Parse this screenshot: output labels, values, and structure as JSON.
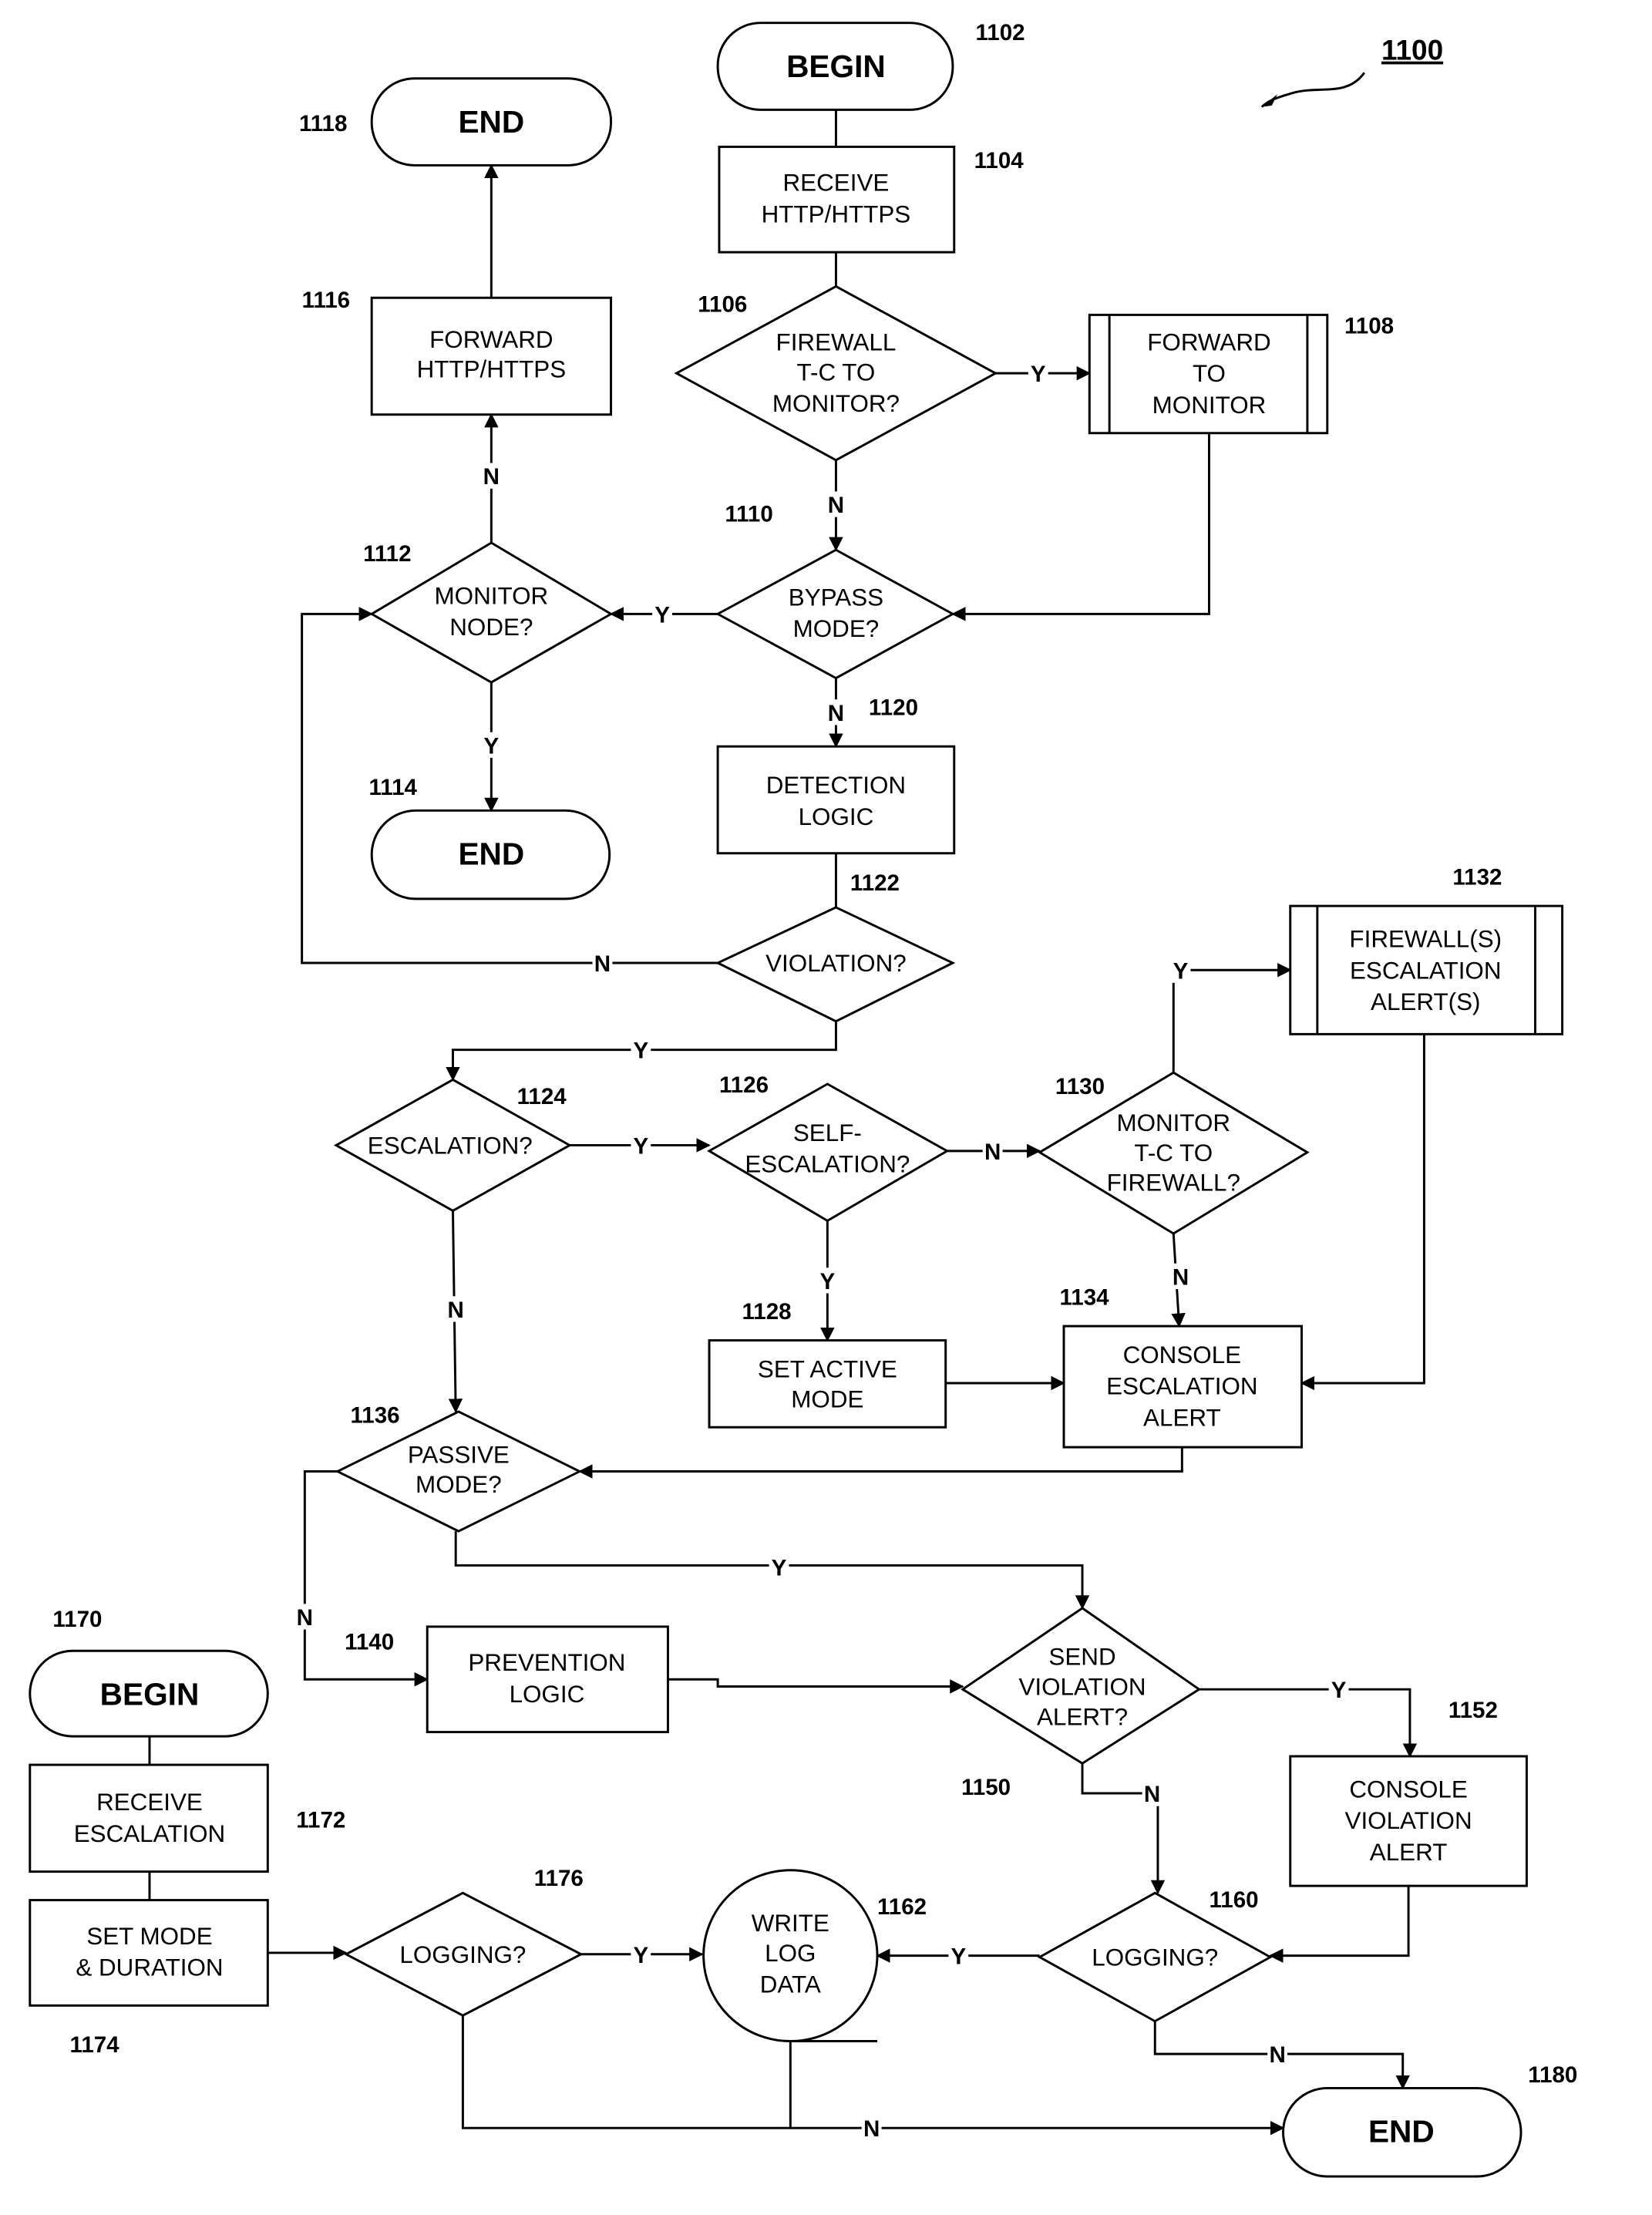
{
  "figure": {
    "number": "1100",
    "type": "flowchart"
  },
  "nodes": [
    {
      "id": "1102",
      "kind": "terminal",
      "lines": [
        "BEGIN"
      ]
    },
    {
      "id": "1104",
      "kind": "process",
      "lines": [
        "RECEIVE",
        "HTTP/HTTPS"
      ]
    },
    {
      "id": "1106",
      "kind": "decision",
      "lines": [
        "FIREWALL",
        "T-C TO",
        "MONITOR?"
      ]
    },
    {
      "id": "1108",
      "kind": "predefined",
      "lines": [
        "FORWARD",
        "TO",
        "MONITOR"
      ]
    },
    {
      "id": "1110",
      "kind": "decision",
      "lines": [
        "BYPASS",
        "MODE?"
      ]
    },
    {
      "id": "1112",
      "kind": "decision",
      "lines": [
        "MONITOR",
        "NODE?"
      ]
    },
    {
      "id": "1114",
      "kind": "terminal",
      "lines": [
        "END"
      ]
    },
    {
      "id": "1116",
      "kind": "process",
      "lines": [
        "FORWARD",
        "HTTP/HTTPS"
      ]
    },
    {
      "id": "1118",
      "kind": "terminal",
      "lines": [
        "END"
      ]
    },
    {
      "id": "1120",
      "kind": "process",
      "lines": [
        "DETECTION",
        "LOGIC"
      ]
    },
    {
      "id": "1122",
      "kind": "decision",
      "lines": [
        "VIOLATION?"
      ]
    },
    {
      "id": "1124",
      "kind": "decision",
      "lines": [
        "ESCALATION?"
      ]
    },
    {
      "id": "1126",
      "kind": "decision",
      "lines": [
        "SELF-",
        "ESCALATION?"
      ]
    },
    {
      "id": "1128",
      "kind": "process",
      "lines": [
        "SET ACTIVE",
        "MODE"
      ]
    },
    {
      "id": "1130",
      "kind": "decision",
      "lines": [
        "MONITOR",
        "T-C TO",
        "FIREWALL?"
      ]
    },
    {
      "id": "1132",
      "kind": "predefined",
      "lines": [
        "FIREWALL(S)",
        "ESCALATION",
        "ALERT(S)"
      ]
    },
    {
      "id": "1134",
      "kind": "process",
      "lines": [
        "CONSOLE",
        "ESCALATION",
        "ALERT"
      ]
    },
    {
      "id": "1136",
      "kind": "decision",
      "lines": [
        "PASSIVE",
        "MODE?"
      ]
    },
    {
      "id": "1140",
      "kind": "process",
      "lines": [
        "PREVENTION",
        "LOGIC"
      ]
    },
    {
      "id": "1150",
      "kind": "decision",
      "lines": [
        "SEND",
        "VIOLATION",
        "ALERT?"
      ]
    },
    {
      "id": "1152",
      "kind": "process",
      "lines": [
        "CONSOLE",
        "VIOLATION",
        "ALERT"
      ]
    },
    {
      "id": "1160",
      "kind": "decision",
      "lines": [
        "LOGGING?"
      ]
    },
    {
      "id": "1162",
      "kind": "connector",
      "lines": [
        "WRITE",
        "LOG",
        "DATA"
      ]
    },
    {
      "id": "1170",
      "kind": "terminal",
      "lines": [
        "BEGIN"
      ]
    },
    {
      "id": "1172",
      "kind": "process",
      "lines": [
        "RECEIVE",
        "ESCALATION"
      ]
    },
    {
      "id": "1174",
      "kind": "process",
      "lines": [
        "SET MODE",
        "& DURATION"
      ]
    },
    {
      "id": "1176",
      "kind": "decision",
      "lines": [
        "LOGGING?"
      ]
    },
    {
      "id": "1180",
      "kind": "terminal",
      "lines": [
        "END"
      ]
    }
  ],
  "edges": [
    {
      "from": "1102",
      "to": "1104",
      "label": ""
    },
    {
      "from": "1104",
      "to": "1106",
      "label": ""
    },
    {
      "from": "1106",
      "to": "1108",
      "label": "Y"
    },
    {
      "from": "1106",
      "to": "1110",
      "label": "N"
    },
    {
      "from": "1108",
      "to": "1110",
      "label": ""
    },
    {
      "from": "1110",
      "to": "1112",
      "label": "Y"
    },
    {
      "from": "1110",
      "to": "1120",
      "label": "N"
    },
    {
      "from": "1112",
      "to": "1116",
      "label": "N"
    },
    {
      "from": "1112",
      "to": "1114",
      "label": "Y"
    },
    {
      "from": "1116",
      "to": "1118",
      "label": ""
    },
    {
      "from": "1120",
      "to": "1122",
      "label": ""
    },
    {
      "from": "1122",
      "to": "1112",
      "label": "N"
    },
    {
      "from": "1122",
      "to": "1124",
      "label": "Y"
    },
    {
      "from": "1124",
      "to": "1126",
      "label": "Y"
    },
    {
      "from": "1124",
      "to": "1136",
      "label": "N"
    },
    {
      "from": "1126",
      "to": "1130",
      "label": "N"
    },
    {
      "from": "1126",
      "to": "1128",
      "label": "Y"
    },
    {
      "from": "1130",
      "to": "1132",
      "label": "Y"
    },
    {
      "from": "1130",
      "to": "1134",
      "label": "N"
    },
    {
      "from": "1128",
      "to": "1134",
      "label": ""
    },
    {
      "from": "1132",
      "to": "1134",
      "label": ""
    },
    {
      "from": "1134",
      "to": "1136",
      "label": ""
    },
    {
      "from": "1136",
      "to": "1150",
      "label": "Y"
    },
    {
      "from": "1136",
      "to": "1140",
      "label": "N"
    },
    {
      "from": "1140",
      "to": "1150",
      "label": ""
    },
    {
      "from": "1150",
      "to": "1152",
      "label": "Y"
    },
    {
      "from": "1150",
      "to": "1160",
      "label": "N"
    },
    {
      "from": "1152",
      "to": "1160",
      "label": ""
    },
    {
      "from": "1160",
      "to": "1162",
      "label": "Y"
    },
    {
      "from": "1160",
      "to": "1180",
      "label": "N"
    },
    {
      "from": "1170",
      "to": "1172",
      "label": ""
    },
    {
      "from": "1172",
      "to": "1174",
      "label": ""
    },
    {
      "from": "1174",
      "to": "1176",
      "label": ""
    },
    {
      "from": "1176",
      "to": "1162",
      "label": "Y"
    },
    {
      "from": "1176",
      "to": "1180",
      "label": "N"
    },
    {
      "from": "1162",
      "to": "1180",
      "label": ""
    }
  ],
  "branch_labels": {
    "yes": "Y",
    "no": "N"
  }
}
